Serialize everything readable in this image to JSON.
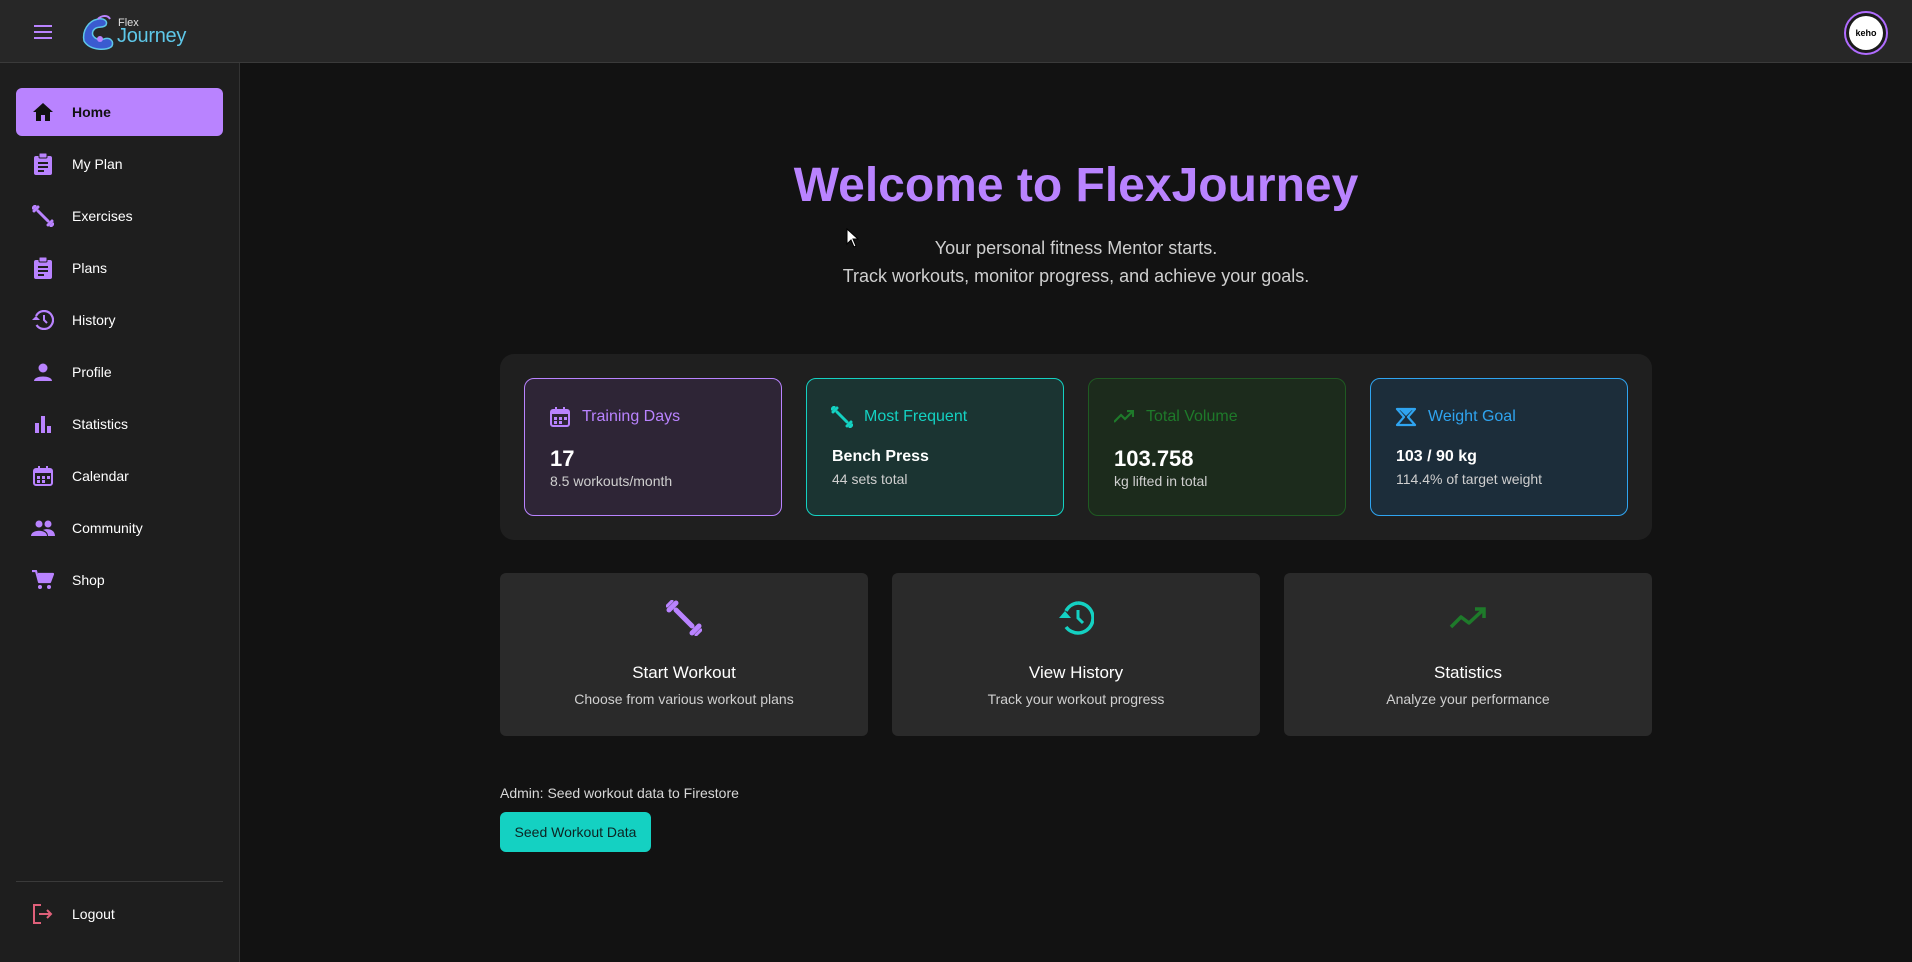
{
  "header": {
    "logo_small": "Flex",
    "logo_large": "Journey",
    "avatar_text": "keho"
  },
  "sidebar": {
    "items": [
      {
        "label": "Home",
        "icon": "home-icon",
        "active": true
      },
      {
        "label": "My Plan",
        "icon": "clipboard-icon"
      },
      {
        "label": "Exercises",
        "icon": "dumbbell-icon"
      },
      {
        "label": "Plans",
        "icon": "clipboard-icon"
      },
      {
        "label": "History",
        "icon": "history-icon"
      },
      {
        "label": "Profile",
        "icon": "person-icon"
      },
      {
        "label": "Statistics",
        "icon": "bar-chart-icon"
      },
      {
        "label": "Calendar",
        "icon": "calendar-icon"
      },
      {
        "label": "Community",
        "icon": "people-icon"
      },
      {
        "label": "Shop",
        "icon": "cart-icon"
      }
    ],
    "logout_label": "Logout"
  },
  "hero": {
    "title": "Welcome to FlexJourney",
    "subtitle_line1": "Your personal fitness Mentor starts.",
    "subtitle_line2": "Track workouts, monitor progress, and achieve your goals."
  },
  "stats": [
    {
      "title": "Training Days",
      "value": "17",
      "sub": "8.5 workouts/month",
      "icon": "calendar-icon",
      "color": "#b983ff"
    },
    {
      "title": "Most Frequent",
      "value": "Bench Press",
      "sub": "44 sets total",
      "icon": "dumbbell-icon",
      "color": "#14d1c2"
    },
    {
      "title": "Total Volume",
      "value": "103.758",
      "sub": "kg lifted in total",
      "icon": "trending-up-icon",
      "color": "#1e7a2a"
    },
    {
      "title": "Weight Goal",
      "value": "103 / 90 kg",
      "sub": "114.4% of target weight",
      "icon": "scale-icon",
      "color": "#2fa4f0"
    }
  ],
  "actions": [
    {
      "title": "Start Workout",
      "desc": "Choose from various workout plans",
      "icon": "dumbbell-icon",
      "color": "#b983ff"
    },
    {
      "title": "View History",
      "desc": "Track your workout progress",
      "icon": "history-icon",
      "color": "#14d1c2"
    },
    {
      "title": "Statistics",
      "desc": "Analyze your performance",
      "icon": "trending-up-icon",
      "color": "#1e7a2a"
    }
  ],
  "admin": {
    "label": "Admin: Seed workout data to Firestore",
    "button_label": "Seed Workout Data"
  },
  "colors": {
    "accent": "#b983ff",
    "teal": "#14d1c2",
    "green": "#1e7a2a",
    "blue": "#2fa4f0",
    "logout": "#e0607a"
  }
}
